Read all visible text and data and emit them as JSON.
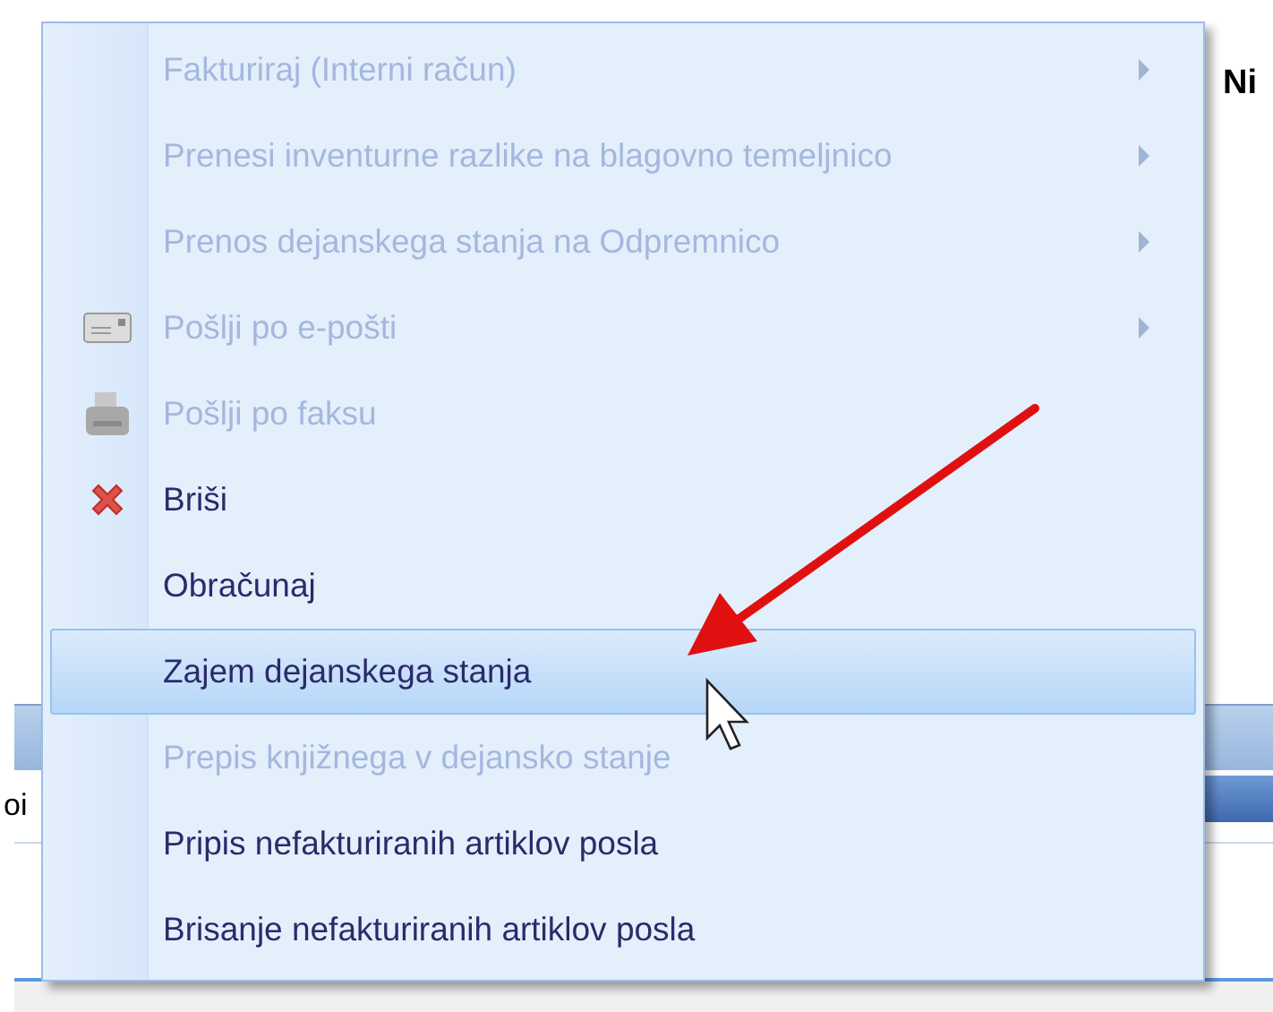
{
  "background": {
    "heading": "Ni",
    "cell_text": "oi"
  },
  "menu": {
    "items": [
      {
        "label": "Fakturiraj (Interni račun)",
        "disabled": true,
        "selected": false,
        "submenu": true
      },
      {
        "label": "Prenesi inventurne razlike na blagovno temeljnico",
        "disabled": true,
        "selected": false,
        "submenu": true
      },
      {
        "label": "Prenos dejanskega stanja na Odpremnico",
        "disabled": true,
        "selected": false,
        "submenu": true
      },
      {
        "label": "Pošlji po e-pošti",
        "disabled": true,
        "selected": false,
        "submenu": true,
        "kind": "email"
      },
      {
        "label": "Pošlji po faksu",
        "disabled": true,
        "selected": false,
        "submenu": false,
        "kind": "fax"
      },
      {
        "label": "Briši",
        "disabled": false,
        "selected": false,
        "submenu": false,
        "kind": "delete"
      },
      {
        "label": "Obračunaj",
        "disabled": false,
        "selected": false,
        "submenu": false
      },
      {
        "label": "Zajem dejanskega stanja",
        "disabled": false,
        "selected": true,
        "submenu": false
      },
      {
        "label": "Prepis knjižnega v dejansko stanje",
        "disabled": true,
        "selected": false,
        "submenu": false
      },
      {
        "label": "Pripis nefakturiranih artiklov posla",
        "disabled": false,
        "selected": false,
        "submenu": false
      },
      {
        "label": "Brisanje nefakturiranih artiklov posla",
        "disabled": false,
        "selected": false,
        "submenu": false
      }
    ]
  }
}
